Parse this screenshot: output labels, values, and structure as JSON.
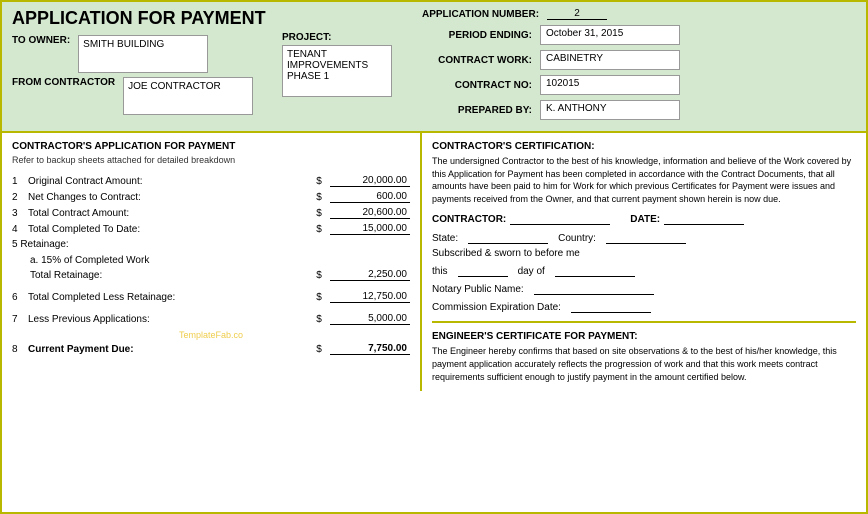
{
  "header": {
    "title": "APPLICATION FOR PAYMENT",
    "to_owner_label": "TO OWNER:",
    "owner_name": "SMITH BUILDING",
    "from_contractor_label": "FROM CONTRACTOR",
    "contractor_name": "JOE CONTRACTOR",
    "project_label": "PROJECT:",
    "project_value": "TENANT\nIMPROVEMENTS\nPHASE 1",
    "app_number_label": "APPLICATION NUMBER:",
    "app_number_value": "2",
    "period_ending_label": "PERIOD ENDING:",
    "period_ending_value": "October 31, 2015",
    "contract_work_label": "CONTRACT WORK:",
    "contract_work_value": "CABINETRY",
    "contract_no_label": "CONTRACT NO:",
    "contract_no_value": "102015",
    "prepared_by_label": "PREPARED BY:",
    "prepared_by_value": "K. ANTHONY"
  },
  "left_panel": {
    "section_title": "CONTRACTOR'S APPLICATION FOR PAYMENT",
    "section_subtitle": "Refer to backup sheets attached for detailed breakdown",
    "line_items": [
      {
        "number": "1",
        "desc": "Original Contract Amount:",
        "dollar": "$",
        "amount": "20,000.00"
      },
      {
        "number": "2",
        "desc": "Net Changes to Contract:",
        "dollar": "$",
        "amount": "600.00"
      },
      {
        "number": "3",
        "desc": "Total Contract Amount:",
        "dollar": "$",
        "amount": "20,600.00"
      },
      {
        "number": "4",
        "desc": "Total Completed To Date:",
        "dollar": "$",
        "amount": "15,000.00"
      }
    ],
    "retainage_label": "5 Retainage:",
    "retainage_sub_label": "a.     15% of Completed Work",
    "total_retainage_label": "Total Retainage:",
    "total_retainage_dollar": "$",
    "total_retainage_amount": "2,250.00",
    "line6_number": "6",
    "line6_desc": "Total Completed Less Retainage:",
    "line6_dollar": "$",
    "line6_amount": "12,750.00",
    "line7_number": "7",
    "line7_desc": "Less Previous Applications:",
    "line7_dollar": "$",
    "line7_amount": "5,000.00",
    "watermark": "TemplateFab.co",
    "line8_number": "8",
    "line8_desc": "Current Payment Due:",
    "line8_dollar": "$",
    "line8_amount": "7,750.00"
  },
  "right_panel": {
    "cert_title": "CONTRACTOR'S CERTIFICATION:",
    "cert_text": "The undersigned Contractor to the best of his knowledge, information and believe of the Work covered by this Application for Payment has been completed in accordance with the Contract Documents, that all amounts have been paid to him for Work for which previous Certificates for Payment were issues and payments received from the Owner, and that current payment shown herein is now due.",
    "contractor_label": "CONTRACTOR:",
    "date_label": "DATE:",
    "state_label": "State:",
    "country_label": "Country:",
    "subscribed_label": "Subscribed & sworn to before me",
    "this_label": "this",
    "day_of_label": "day of",
    "notary_label": "Notary Public Name:",
    "commission_label": "Commission Expiration Date:",
    "engineer_title": "ENGINEER'S CERTIFICATE FOR PAYMENT:",
    "engineer_text": "The Engineer hereby confirms that based on site observations & to the best of his/her knowledge, this payment application accurately reflects the progression of work and that this work meets contract requirements sufficient enough to justify payment in the amount certified below."
  }
}
